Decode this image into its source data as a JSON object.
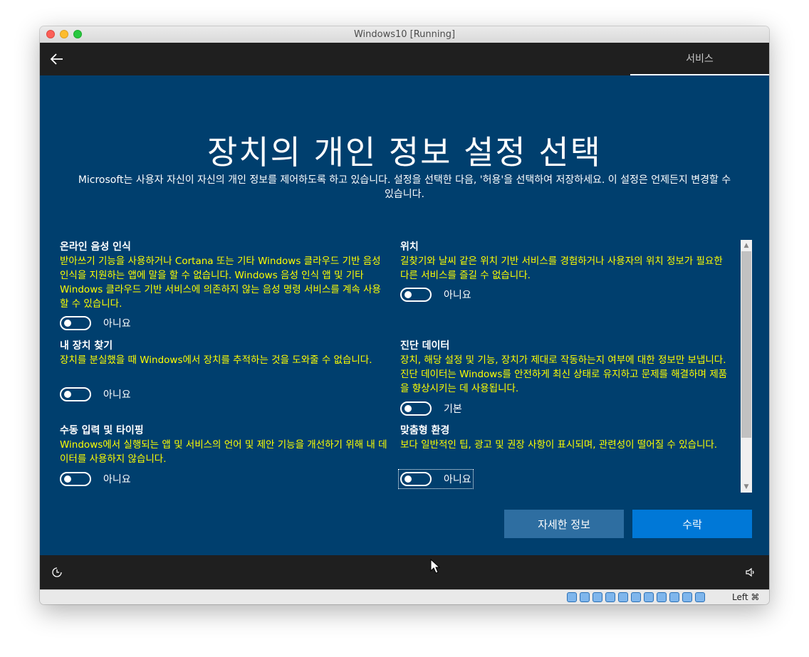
{
  "window": {
    "title": "Windows10 [Running]"
  },
  "topbar": {
    "tab_label": "서비스"
  },
  "page": {
    "heading": "장치의 개인 정보 설정 선택",
    "description": "Microsoft는 사용자 자신이 자신의 개인 정보를 제어하도록 하고 있습니다. 설정을 선택한 다음, '허용'을 선택하여 저장하세요. 이 설정은 언제든지 변경할 수 있습니다."
  },
  "settings": [
    {
      "title": "온라인 음성 인식",
      "body": "받아쓰기 기능을 사용하거나 Cortana 또는 기타 Windows 클라우드 기반 음성 인식을 지원하는 앱에 말을 할 수 없습니다. Windows 음성 인식 앱 및 기타 Windows 클라우드 기반 서비스에 의존하지 않는 음성 명령 서비스를 계속 사용할 수 있습니다.",
      "toggle_label": "아니요",
      "state": "off"
    },
    {
      "title": "위치",
      "body": "길찾기와 날씨 같은 위치 기반 서비스를 경험하거나 사용자의 위치 정보가 필요한 다른 서비스를 즐길 수 없습니다.",
      "toggle_label": "아니요",
      "state": "off"
    },
    {
      "title": "내 장치 찾기",
      "body": "장치를 분실했을 때 Windows에서 장치를 추적하는 것을 도와줄 수 없습니다.",
      "toggle_label": "아니요",
      "state": "off"
    },
    {
      "title": "진단 데이터",
      "body": "장치, 해당 설정 및 기능, 장치가 제대로 작동하는지 여부에 대한 정보만 보냅니다. 진단 데이터는 Windows를 안전하게 최신 상태로 유지하고 문제를 해결하며 제품을 향상시키는 데 사용됩니다.",
      "toggle_label": "기본",
      "state": "off"
    },
    {
      "title": "수동 입력 및 타이핑",
      "body": "Windows에서 실행되는 앱 및 서비스의 언어 및 제안 기능을 개선하기 위해 내 데이터를 사용하지 않습니다.",
      "toggle_label": "아니요",
      "state": "off"
    },
    {
      "title": "맞춤형 환경",
      "body": "보다 일반적인 팁, 광고 및 권장 사항이 표시되며, 관련성이 떨어질 수 있습니다.",
      "toggle_label": "아니요",
      "state": "off"
    }
  ],
  "buttons": {
    "more_info": "자세한 정보",
    "accept": "수락"
  },
  "statusbar": {
    "host_key": "Left ⌘"
  },
  "colors": {
    "background": "#003f6e",
    "bar": "#1f1f1f",
    "setting_body": "#ffff00",
    "accept": "#0078d7",
    "more_info": "#2e6ea1"
  },
  "icons": [
    "back-arrow-icon",
    "ease-of-access-icon",
    "volume-icon",
    "mouse-cursor-icon"
  ]
}
